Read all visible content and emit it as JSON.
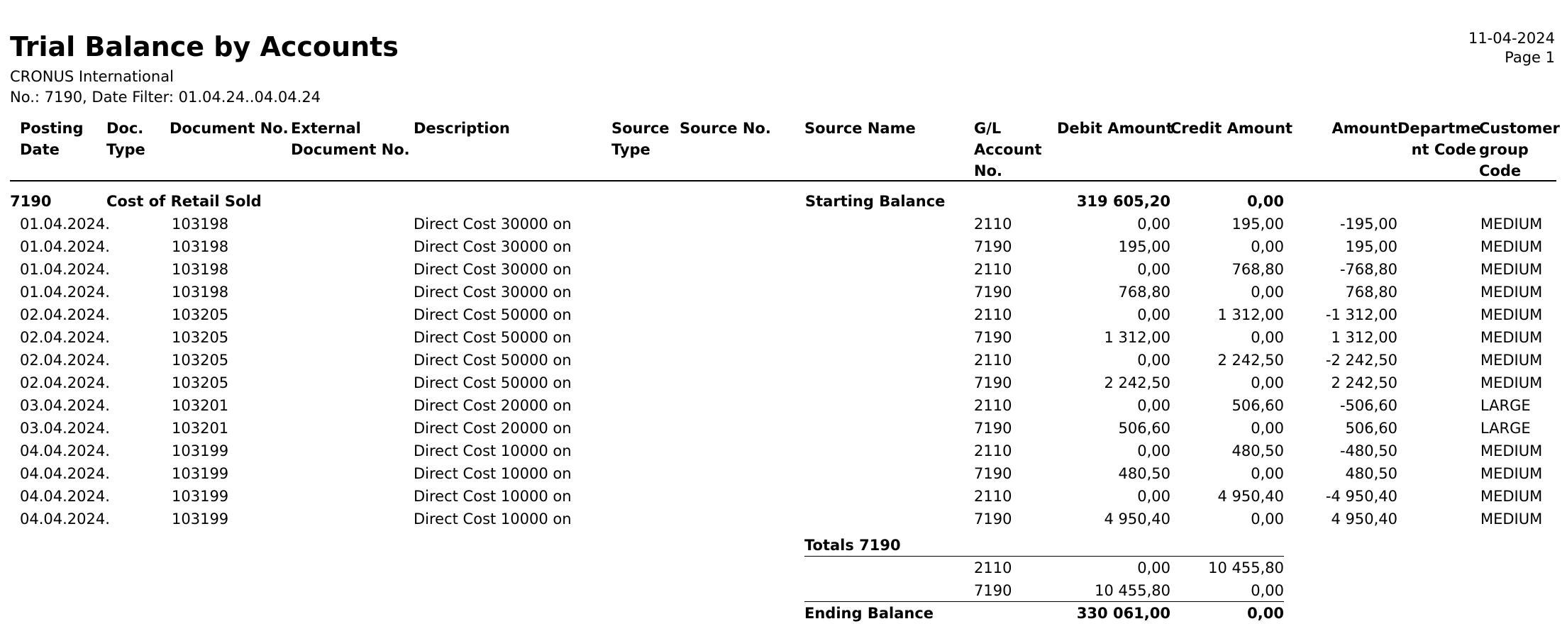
{
  "report": {
    "title": "Trial Balance by Accounts",
    "company": "CRONUS International",
    "filter": "No.: 7190, Date Filter: 01.04.24..04.04.24",
    "date": "11-04-2024",
    "page": "Page 1"
  },
  "columns": [
    {
      "key": "posting_date",
      "lines": [
        "Posting",
        "Date"
      ]
    },
    {
      "key": "doc_type",
      "lines": [
        "Doc.",
        "Type"
      ]
    },
    {
      "key": "document_no",
      "lines": [
        "Document No."
      ]
    },
    {
      "key": "external_document_no",
      "lines": [
        "External",
        "Document No."
      ]
    },
    {
      "key": "description",
      "lines": [
        "Description"
      ]
    },
    {
      "key": "source_type",
      "lines": [
        "Source",
        "Type"
      ]
    },
    {
      "key": "source_no",
      "lines": [
        "Source No."
      ]
    },
    {
      "key": "source_name",
      "lines": [
        "Source Name"
      ]
    },
    {
      "key": "gl_account_no",
      "lines": [
        "G/L",
        "Account",
        "No."
      ]
    },
    {
      "key": "debit_amount",
      "lines": [
        "Debit Amount"
      ]
    },
    {
      "key": "credit_amount",
      "lines": [
        "Credit Amount"
      ]
    },
    {
      "key": "amount",
      "lines": [
        "Amount"
      ]
    },
    {
      "key": "department_code",
      "lines": [
        "Departme",
        "nt Code"
      ]
    },
    {
      "key": "customer_group_code",
      "lines": [
        "Customer",
        "group",
        "Code"
      ]
    }
  ],
  "account_header": {
    "account_no": "7190",
    "account_name": "Cost of Retail Sold",
    "starting_label": "Starting Balance",
    "starting_debit": "319 605,20",
    "starting_credit": "0,00"
  },
  "rows": [
    {
      "posting_date": "01.04.2024.",
      "document_no": "103198",
      "description": "Direct Cost 30000 on",
      "gl": "2110",
      "debit": "0,00",
      "credit": "195,00",
      "amount": "-195,00",
      "customer_group": "MEDIUM"
    },
    {
      "posting_date": "01.04.2024.",
      "document_no": "103198",
      "description": "Direct Cost 30000 on",
      "gl": "7190",
      "debit": "195,00",
      "credit": "0,00",
      "amount": "195,00",
      "customer_group": "MEDIUM"
    },
    {
      "posting_date": "01.04.2024.",
      "document_no": "103198",
      "description": "Direct Cost 30000 on",
      "gl": "2110",
      "debit": "0,00",
      "credit": "768,80",
      "amount": "-768,80",
      "customer_group": "MEDIUM"
    },
    {
      "posting_date": "01.04.2024.",
      "document_no": "103198",
      "description": "Direct Cost 30000 on",
      "gl": "7190",
      "debit": "768,80",
      "credit": "0,00",
      "amount": "768,80",
      "customer_group": "MEDIUM"
    },
    {
      "posting_date": "02.04.2024.",
      "document_no": "103205",
      "description": "Direct Cost 50000 on",
      "gl": "2110",
      "debit": "0,00",
      "credit": "1 312,00",
      "amount": "-1 312,00",
      "customer_group": "MEDIUM"
    },
    {
      "posting_date": "02.04.2024.",
      "document_no": "103205",
      "description": "Direct Cost 50000 on",
      "gl": "7190",
      "debit": "1 312,00",
      "credit": "0,00",
      "amount": "1 312,00",
      "customer_group": "MEDIUM"
    },
    {
      "posting_date": "02.04.2024.",
      "document_no": "103205",
      "description": "Direct Cost 50000 on",
      "gl": "2110",
      "debit": "0,00",
      "credit": "2 242,50",
      "amount": "-2 242,50",
      "customer_group": "MEDIUM"
    },
    {
      "posting_date": "02.04.2024.",
      "document_no": "103205",
      "description": "Direct Cost 50000 on",
      "gl": "7190",
      "debit": "2 242,50",
      "credit": "0,00",
      "amount": "2 242,50",
      "customer_group": "MEDIUM"
    },
    {
      "posting_date": "03.04.2024.",
      "document_no": "103201",
      "description": "Direct Cost 20000 on",
      "gl": "2110",
      "debit": "0,00",
      "credit": "506,60",
      "amount": "-506,60",
      "customer_group": "LARGE"
    },
    {
      "posting_date": "03.04.2024.",
      "document_no": "103201",
      "description": "Direct Cost 20000 on",
      "gl": "7190",
      "debit": "506,60",
      "credit": "0,00",
      "amount": "506,60",
      "customer_group": "LARGE"
    },
    {
      "posting_date": "04.04.2024.",
      "document_no": "103199",
      "description": "Direct Cost 10000 on",
      "gl": "2110",
      "debit": "0,00",
      "credit": "480,50",
      "amount": "-480,50",
      "customer_group": "MEDIUM"
    },
    {
      "posting_date": "04.04.2024.",
      "document_no": "103199",
      "description": "Direct Cost 10000 on",
      "gl": "7190",
      "debit": "480,50",
      "credit": "0,00",
      "amount": "480,50",
      "customer_group": "MEDIUM"
    },
    {
      "posting_date": "04.04.2024.",
      "document_no": "103199",
      "description": "Direct Cost 10000 on",
      "gl": "2110",
      "debit": "0,00",
      "credit": "4 950,40",
      "amount": "-4 950,40",
      "customer_group": "MEDIUM"
    },
    {
      "posting_date": "04.04.2024.",
      "document_no": "103199",
      "description": "Direct Cost 10000 on",
      "gl": "7190",
      "debit": "4 950,40",
      "credit": "0,00",
      "amount": "4 950,40",
      "customer_group": "MEDIUM"
    }
  ],
  "totals": {
    "label": "Totals 7190",
    "lines": [
      {
        "gl": "2110",
        "debit": "0,00",
        "credit": "10 455,80"
      },
      {
        "gl": "7190",
        "debit": "10 455,80",
        "credit": "0,00"
      }
    ],
    "ending_label": "Ending Balance",
    "ending_debit": "330 061,00",
    "ending_credit": "0,00"
  }
}
